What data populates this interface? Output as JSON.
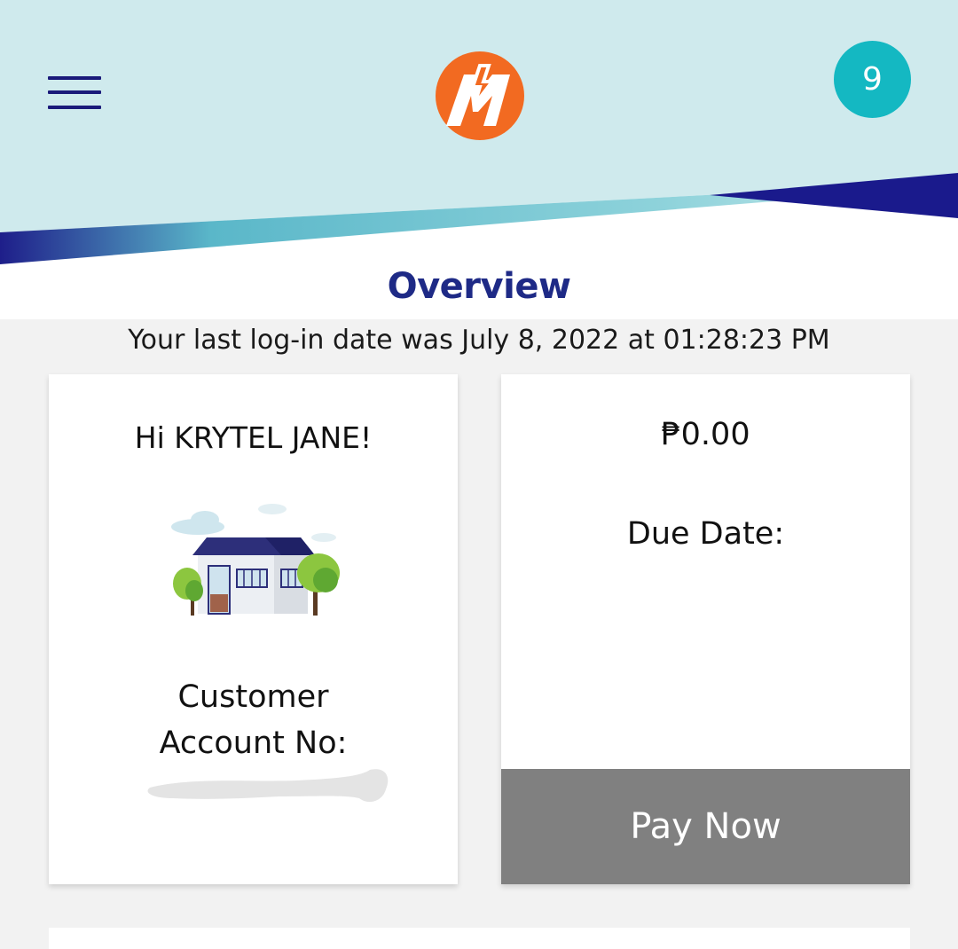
{
  "header": {
    "notification_count": "9",
    "colors": {
      "header_bg": "#cfeaed",
      "navy": "#1a1a8c",
      "accent": "#14b8c2",
      "logo_orange": "#f26a21"
    }
  },
  "page": {
    "title": "Overview",
    "last_login": "Your last log-in date was July 8, 2022 at 01:28:23 PM"
  },
  "account_card": {
    "greeting": "Hi KRYTEL JANE!",
    "account_label_line1": "Customer",
    "account_label_line2": "Account No:",
    "image": "house-illustration"
  },
  "bill_card": {
    "amount": "₱0.00",
    "due_date_label": "Due Date:",
    "pay_button_label": "Pay Now"
  },
  "icons": [
    "menu-icon",
    "meralco-logo",
    "notification-badge"
  ]
}
